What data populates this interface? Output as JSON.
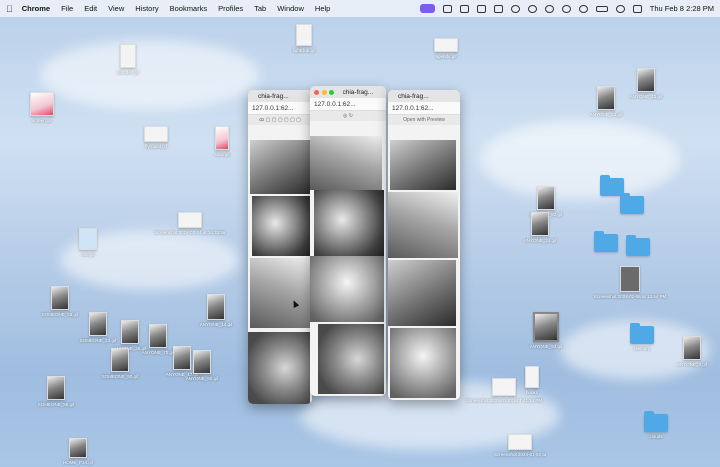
{
  "menubar": {
    "app": "Chrome",
    "menus": [
      "File",
      "Edit",
      "View",
      "History",
      "Bookmarks",
      "Profiles",
      "Tab",
      "Window",
      "Help"
    ],
    "clock": "Thu Feb 8  2:28 PM"
  },
  "windows": [
    {
      "title": "chia-frag...",
      "url": "127.0.0.1:62...",
      "toolbar": "ꝏ ▢ ▢ ▢ ▢ ▢ ▢"
    },
    {
      "title": "chia-frag...",
      "url": "127.0.0.1:62...",
      "toolbar": "◎  ↻"
    },
    {
      "title": "chia-frag...",
      "url": "127.0.0.1:62...",
      "toolbar": "Open with Preview"
    }
  ],
  "desktop_icons": [
    {
      "label": "tinh.dev.gif"
    },
    {
      "label": "fightclub.gif"
    },
    {
      "label": "agenda.gif"
    },
    {
      "label": "screen.gif"
    },
    {
      "label": "flyroplat.gif"
    },
    {
      "label": "slow.gif"
    },
    {
      "label": "Screenshot 2024-02-04 at 14.33.56"
    },
    {
      "label": "ANYONE_51.gif"
    },
    {
      "label": "ANYONE_82.gif"
    },
    {
      "label": "ANYONE_12.gif"
    },
    {
      "label": "SOMEONE_28.gif"
    },
    {
      "label": "ANYONE_35.gif"
    },
    {
      "label": "ANYONE_70.gif"
    },
    {
      "label": "ANYONE_14.gif"
    },
    {
      "label": "ANYONE_17.gif"
    },
    {
      "label": "ANYONE_60.gif"
    },
    {
      "label": "ANYONE_93.gif"
    },
    {
      "label": "SOMEONE_58.gif"
    },
    {
      "label": "SOMEONE_90.gif"
    },
    {
      "label": "HOME_P14.gif"
    },
    {
      "label": "edit.gif"
    },
    {
      "label": "hooks"
    },
    {
      "label": "Screenshot 2024-01-02 at 7.41.14 PM"
    },
    {
      "label": "Screenshot 2024-01-02 at"
    },
    {
      "label": "Screenshot 2024-02-06 at 13.54 PM"
    },
    {
      "label": "Memory"
    },
    {
      "label": "clouds"
    },
    {
      "label": "ANYONE_3.gif"
    },
    {
      "label": "ANYONE_24.gif"
    },
    {
      "label": "SOMEONE_13.gif"
    }
  ]
}
